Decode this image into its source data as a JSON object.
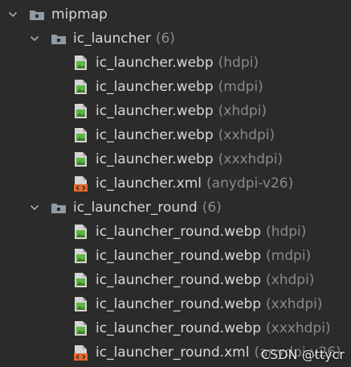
{
  "tree": {
    "root": {
      "label": "mipmap",
      "icon": "folder-icon"
    },
    "groups": [
      {
        "label": "ic_launcher",
        "count": "(6)",
        "icon": "folder-icon",
        "files": [
          {
            "name": "ic_launcher.webp",
            "qualifier": "(hdpi)",
            "icon": "image-file-icon"
          },
          {
            "name": "ic_launcher.webp",
            "qualifier": "(mdpi)",
            "icon": "image-file-icon"
          },
          {
            "name": "ic_launcher.webp",
            "qualifier": "(xhdpi)",
            "icon": "image-file-icon"
          },
          {
            "name": "ic_launcher.webp",
            "qualifier": "(xxhdpi)",
            "icon": "image-file-icon"
          },
          {
            "name": "ic_launcher.webp",
            "qualifier": "(xxxhdpi)",
            "icon": "image-file-icon"
          },
          {
            "name": "ic_launcher.xml",
            "qualifier": "(anydpi-v26)",
            "icon": "xml-file-icon"
          }
        ]
      },
      {
        "label": "ic_launcher_round",
        "count": "(6)",
        "icon": "folder-icon",
        "files": [
          {
            "name": "ic_launcher_round.webp",
            "qualifier": "(hdpi)",
            "icon": "image-file-icon"
          },
          {
            "name": "ic_launcher_round.webp",
            "qualifier": "(mdpi)",
            "icon": "image-file-icon"
          },
          {
            "name": "ic_launcher_round.webp",
            "qualifier": "(xhdpi)",
            "icon": "image-file-icon"
          },
          {
            "name": "ic_launcher_round.webp",
            "qualifier": "(xxhdpi)",
            "icon": "image-file-icon"
          },
          {
            "name": "ic_launcher_round.webp",
            "qualifier": "(xxxhdpi)",
            "icon": "image-file-icon"
          },
          {
            "name": "ic_launcher_round.xml",
            "qualifier": "(anydpi-v26)",
            "icon": "xml-file-icon"
          }
        ]
      }
    ]
  },
  "watermark": "CSDN @ttycr",
  "colors": {
    "background": "#2b2b2b",
    "text": "#d8d8d8",
    "qualifier": "#8a8a8a",
    "folder": "#8f9aa3",
    "image_icon_green": "#62b543",
    "xml_icon_orange": "#e46a2e"
  }
}
